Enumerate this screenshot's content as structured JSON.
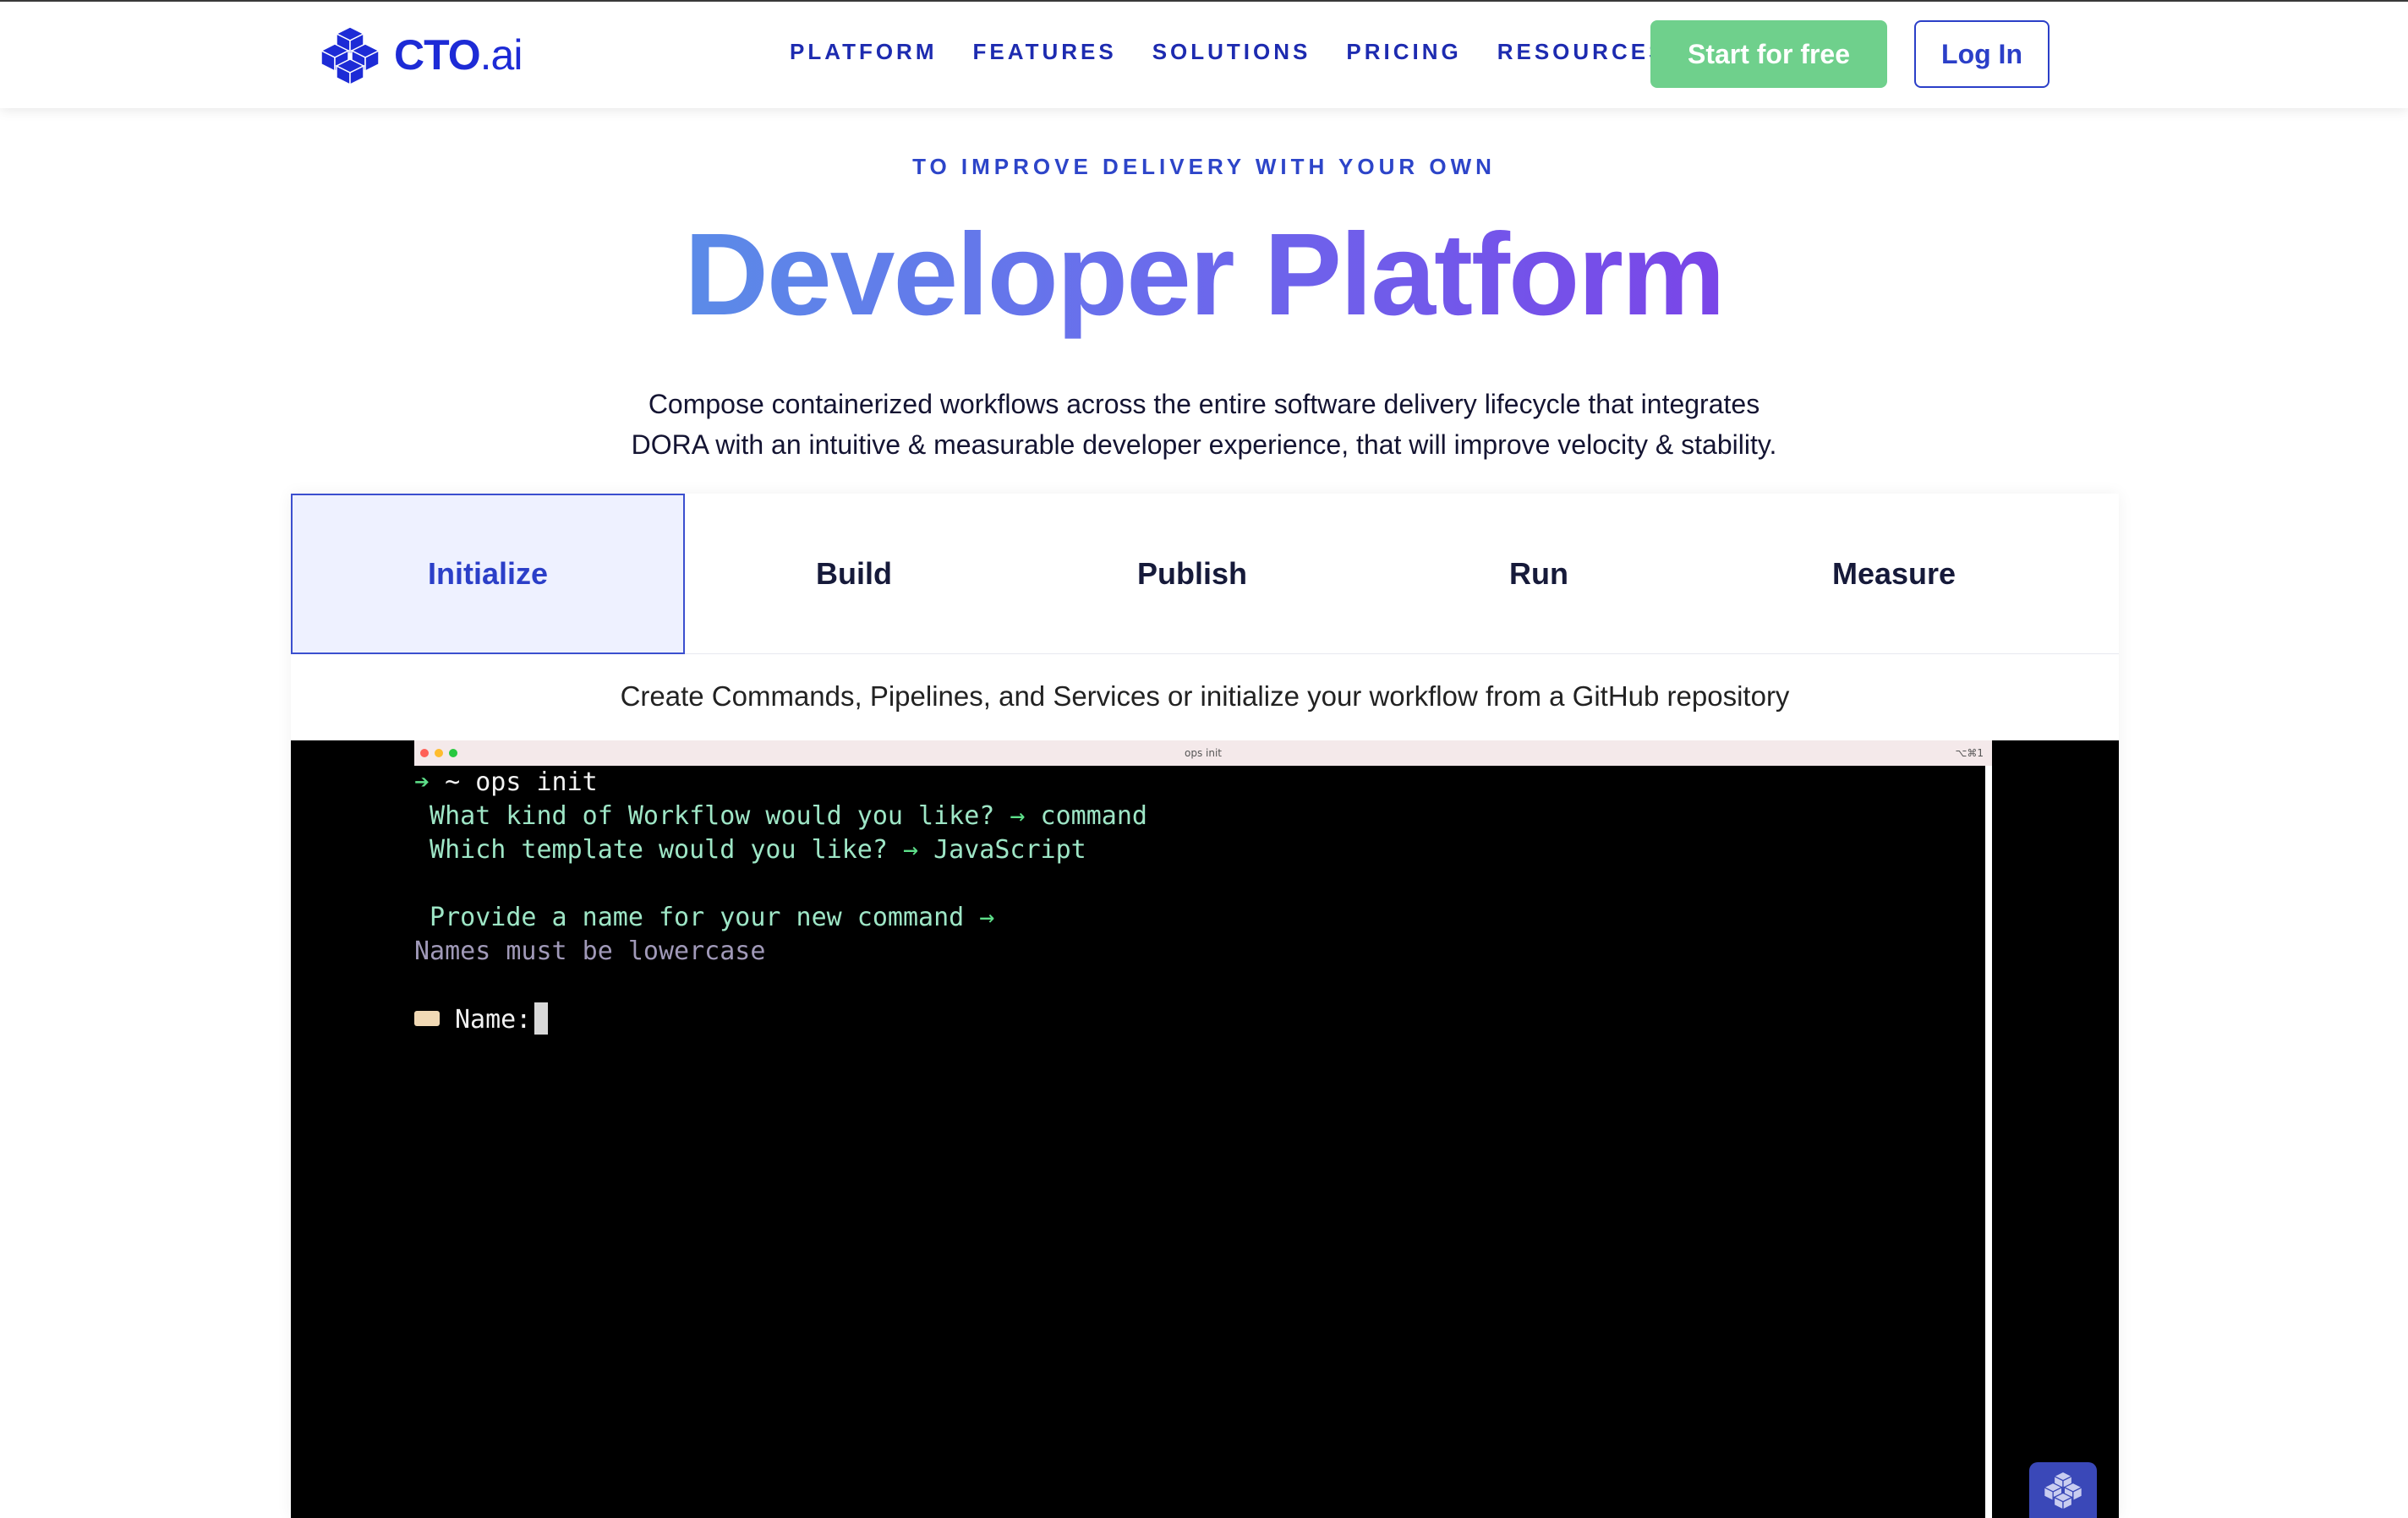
{
  "header": {
    "logo": {
      "brand": "CTO",
      "suffix": ".ai"
    },
    "nav": [
      "PLATFORM",
      "FEATURES",
      "SOLUTIONS",
      "PRICING",
      "RESOURCES"
    ],
    "cta_start": "Start for free",
    "cta_login": "Log In"
  },
  "hero": {
    "eyebrow": "TO IMPROVE DELIVERY WITH YOUR OWN",
    "title": "Developer Platform",
    "description_line1": "Compose containerized workflows across the entire software delivery lifecycle that integrates",
    "description_line2": "DORA with an intuitive & measurable developer experience, that will improve velocity & stability."
  },
  "tabs": {
    "items": [
      "Initialize",
      "Build",
      "Publish",
      "Run",
      "Measure"
    ],
    "active": "Initialize",
    "caption": "Create Commands, Pipelines, and Services or initialize your workflow from a GitHub repository"
  },
  "terminal": {
    "window_title": "ops init",
    "shortcut": "⌥⌘1",
    "prompt_arrow": "➔",
    "prompt_cmd": " ~ ops init",
    "q1": " What kind of Workflow would you like?",
    "q1_answer": "command",
    "q2": " Which template would you like?",
    "q2_answer": "JavaScript",
    "q3": " Provide a name for your new command",
    "hint": "Names must be lowercase",
    "name_label": "Name:",
    "answer_arrow": "→"
  },
  "colors": {
    "brand_blue": "#1d2bd6",
    "cta_green": "#6fd08c",
    "terminal_green": "#5ee08a"
  }
}
